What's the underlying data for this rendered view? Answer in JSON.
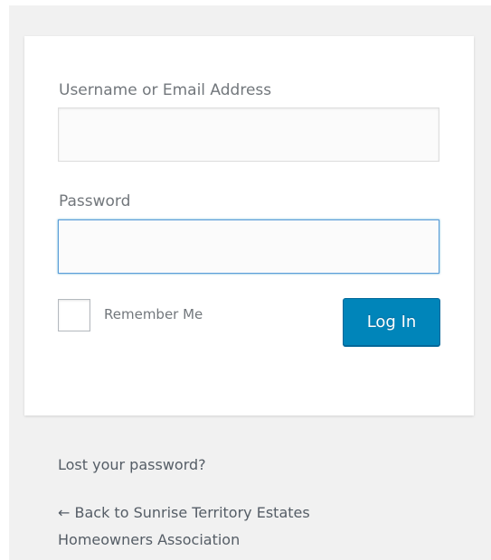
{
  "login_form": {
    "username_label": "Username or Email Address",
    "username_value": "",
    "password_label": "Password",
    "password_value": "",
    "remember_label": "Remember Me",
    "remember_checked": false,
    "submit_label": "Log In"
  },
  "links": {
    "lost_password": "Lost your password?",
    "back_arrow": "←",
    "back_text": "Back to Sunrise Territory Estates Homeowners Association"
  },
  "colors": {
    "page_background": "#f1f1f1",
    "card_background": "#ffffff",
    "primary_button": "#0085ba",
    "focus_border": "#5b9dd9",
    "label_text": "#72777c",
    "link_text": "#555d66"
  }
}
